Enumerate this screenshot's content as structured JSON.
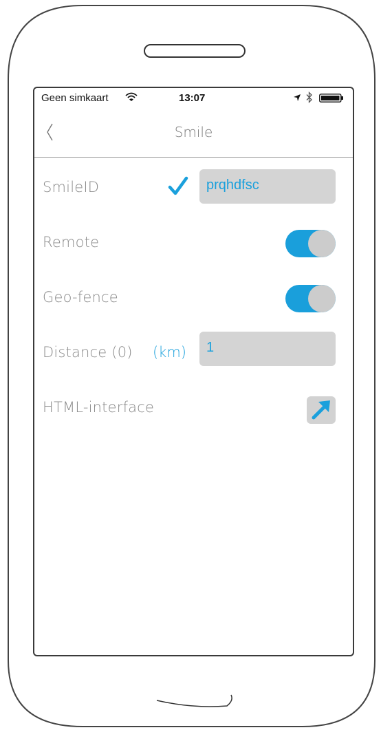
{
  "status_bar": {
    "carrier": "Geen simkaart",
    "time": "13:07"
  },
  "nav": {
    "title": "Smile"
  },
  "settings": {
    "smile_id": {
      "label": "SmileID",
      "value": "prqhdfsc",
      "verified": true
    },
    "remote": {
      "label": "Remote",
      "on": true
    },
    "geofence": {
      "label": "Geo-fence",
      "on": true
    },
    "distance": {
      "label": "Distance (0)",
      "unit": "(km)",
      "value": "1"
    },
    "html_interface": {
      "label": "HTML-interface"
    }
  },
  "colors": {
    "accent": "#1aa0dc",
    "label": "#8a8a8a",
    "field_bg": "#d4d4d4",
    "toggle_knob": "#cccccc"
  },
  "icons": {
    "wifi": "wifi-icon",
    "location": "location-arrow-icon",
    "bluetooth": "bluetooth-icon",
    "battery": "battery-icon",
    "back": "chevron-left-icon",
    "check": "checkmark-icon",
    "open": "external-link-arrow-icon"
  }
}
